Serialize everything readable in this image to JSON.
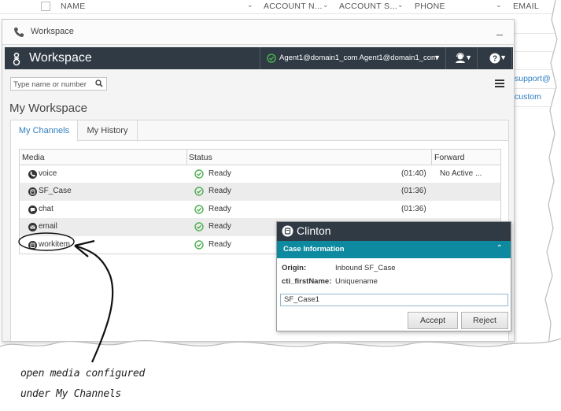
{
  "background_list": {
    "columns": [
      {
        "label": "NAME"
      },
      {
        "label": "ACCOUNT N..."
      },
      {
        "label": "ACCOUNT S..."
      },
      {
        "label": "PHONE"
      },
      {
        "label": "EMAIL"
      }
    ],
    "email_snippets": [
      "support@",
      "custom"
    ]
  },
  "window": {
    "title": "Workspace",
    "minimize_label": "_"
  },
  "topbar": {
    "brand": "Workspace",
    "agent_label": "Agent1@domain1_com Agent1@domain1_com",
    "status_color": "#4caf50"
  },
  "search": {
    "placeholder": "Type name or number"
  },
  "page_title": "My Workspace",
  "tabs": [
    {
      "label": "My Channels",
      "active": true
    },
    {
      "label": "My History",
      "active": false
    }
  ],
  "channels": {
    "headers": {
      "media": "Media",
      "status": "Status",
      "forward": "Forward"
    },
    "rows": [
      {
        "media": "voice",
        "icon": "phone-icon",
        "status": "Ready",
        "time": "(01:40)",
        "forward": "No Active ..."
      },
      {
        "media": "SF_Case",
        "icon": "case-icon",
        "status": "Ready",
        "time": "(01:36)",
        "forward": ""
      },
      {
        "media": "chat",
        "icon": "chat-icon",
        "status": "Ready",
        "time": "(01:36)",
        "forward": ""
      },
      {
        "media": "email",
        "icon": "email-icon",
        "status": "Ready",
        "time": "",
        "forward": ""
      },
      {
        "media": "workitem",
        "icon": "workitem-icon",
        "status": "Ready",
        "time": "",
        "forward": ""
      }
    ]
  },
  "toast": {
    "name": "Clinton",
    "section": "Case Information",
    "fields": [
      {
        "key": "Origin:",
        "value": "Inbound SF_Case"
      },
      {
        "key": "cti_firstName:",
        "value": "Uniquename"
      }
    ],
    "case_id": "SF_Case1",
    "accept_label": "Accept",
    "reject_label": "Reject"
  },
  "callout": {
    "line1": "open media configured",
    "line2": "under My Channels"
  }
}
